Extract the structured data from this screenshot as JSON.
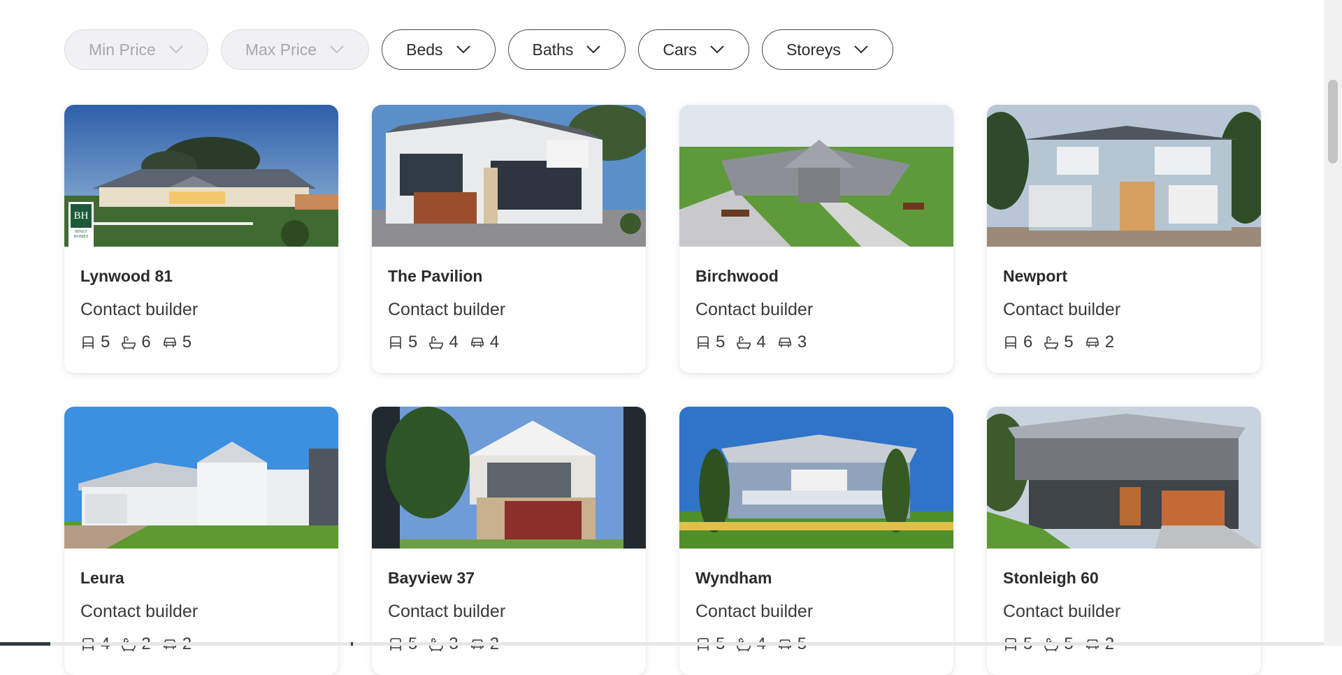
{
  "filters": [
    {
      "label": "Min Price",
      "disabled": true
    },
    {
      "label": "Max Price",
      "disabled": true
    },
    {
      "label": "Beds",
      "disabled": false
    },
    {
      "label": "Baths",
      "disabled": false
    },
    {
      "label": "Cars",
      "disabled": false
    },
    {
      "label": "Storeys",
      "disabled": false
    }
  ],
  "listings": [
    {
      "name": "Lynwood 81",
      "price": "Contact builder",
      "beds": "5",
      "baths": "6",
      "cars": "5",
      "badge": {
        "mark": "BH",
        "text": "BINET HOMES"
      }
    },
    {
      "name": "The Pavilion",
      "price": "Contact builder",
      "beds": "5",
      "baths": "4",
      "cars": "4"
    },
    {
      "name": "Birchwood",
      "price": "Contact builder",
      "beds": "5",
      "baths": "4",
      "cars": "3"
    },
    {
      "name": "Newport",
      "price": "Contact builder",
      "beds": "6",
      "baths": "5",
      "cars": "2"
    },
    {
      "name": "Leura",
      "price": "Contact builder",
      "beds": "4",
      "baths": "2",
      "cars": "2"
    },
    {
      "name": "Bayview 37",
      "price": "Contact builder",
      "beds": "5",
      "baths": "3",
      "cars": "2"
    },
    {
      "name": "Wyndham",
      "price": "Contact builder",
      "beds": "5",
      "baths": "4",
      "cars": "5"
    },
    {
      "name": "Stonleigh 60",
      "price": "Contact builder",
      "beds": "5",
      "baths": "5",
      "cars": "2"
    }
  ],
  "icons": {
    "bed": "bed-icon",
    "bath": "bath-icon",
    "car": "car-icon",
    "chevron": "chevron-down-icon"
  }
}
